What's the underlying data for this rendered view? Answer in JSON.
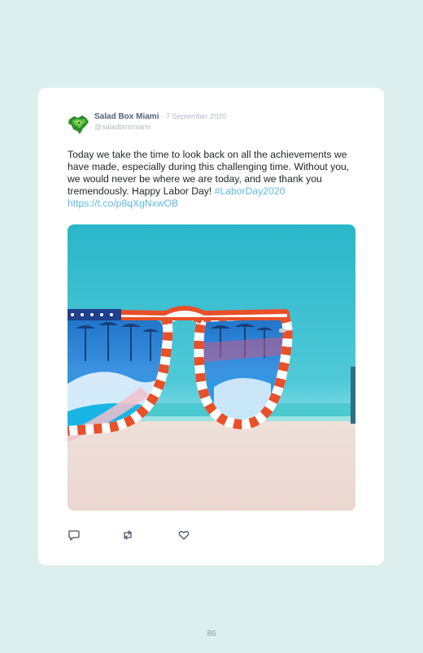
{
  "tweet": {
    "author_name": "Salad Box Miami",
    "separator": "·",
    "date": "7 September 2020",
    "handle": "@saladboxmiami",
    "text": "Today we take the time to look back on all the achievements we have made, especially during this challenging time. Without you, we would never be where we are today, and we thank you tremendously. Happy Labor Day!",
    "hashtag": "#LaborDay2020",
    "link": "https://t.co/p8qXgNxwOB",
    "image_description_icon": "sunglasses-beach-photo"
  },
  "actions": {
    "reply_icon": "reply-icon",
    "retweet_icon": "retweet-icon",
    "like_icon": "heart-icon"
  },
  "page_number": "86",
  "colors": {
    "background": "#dcefee",
    "card": "#ffffff",
    "link": "#5fb9e1",
    "author": "#56607a",
    "muted": "#b4bac4"
  }
}
